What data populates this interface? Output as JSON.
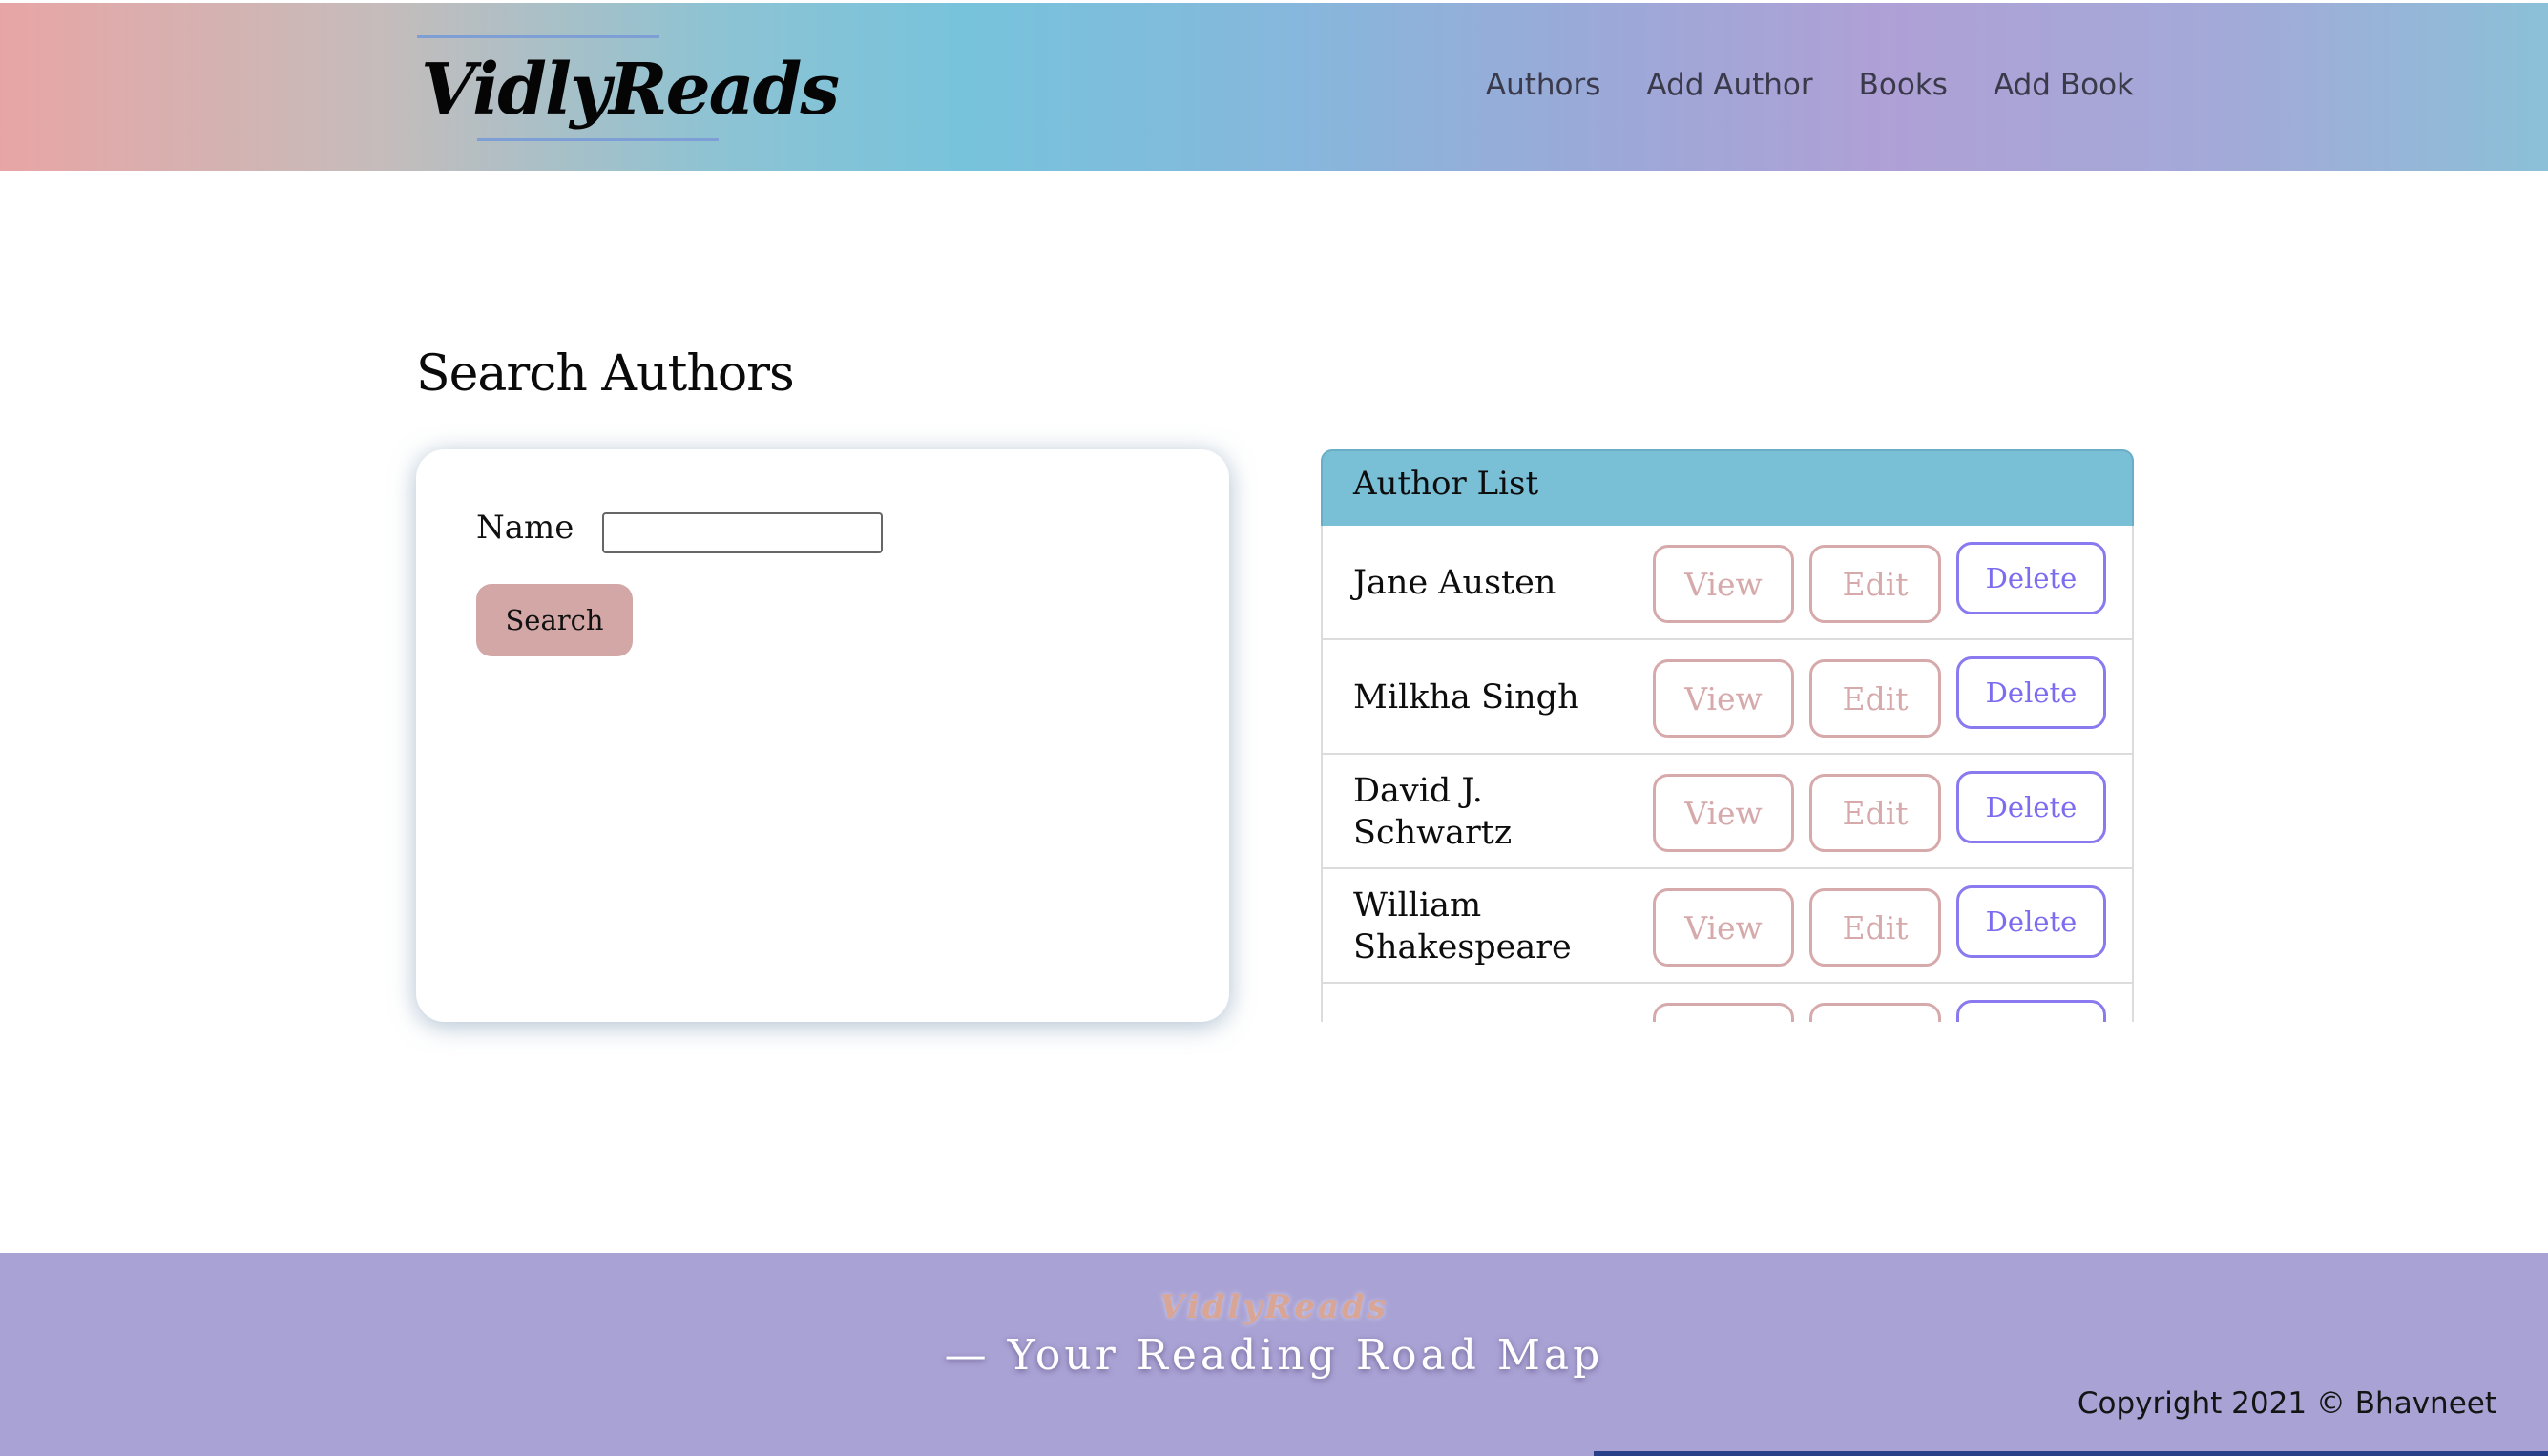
{
  "header": {
    "logo": "VidlyReads",
    "nav": [
      "Authors",
      "Add Author",
      "Books",
      "Add Book"
    ]
  },
  "main": {
    "title": "Search Authors",
    "search": {
      "name_label": "Name",
      "name_value": "",
      "button_label": "Search"
    },
    "list": {
      "header": "Author List",
      "authors": [
        "Jane Austen",
        "Milkha Singh",
        "David J. Schwartz",
        "William Shakespeare",
        ""
      ],
      "view_label": "View",
      "edit_label": "Edit",
      "delete_label": "Delete"
    }
  },
  "footer": {
    "brand": "VidlyReads",
    "tagline": "— Your Reading Road Map",
    "copyright": "Copyright 2021 © Bhavneet"
  },
  "colors": {
    "footer_bg": "#a9a2d4",
    "list_header_bg": "#79bfd6",
    "search_button_bg": "#d4a7a7",
    "view_edit_border": "#d6a9ab",
    "delete_border": "#8a7af0"
  }
}
